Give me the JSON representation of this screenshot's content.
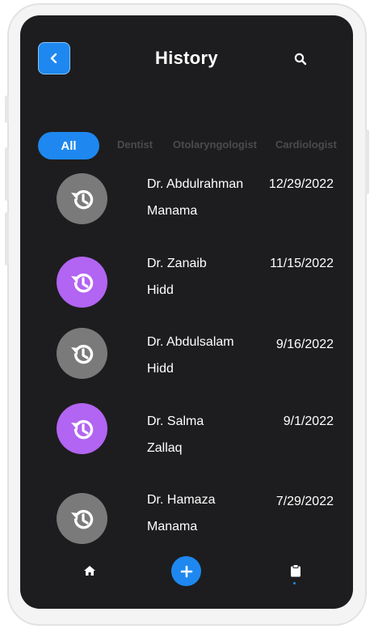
{
  "header": {
    "title": "History",
    "back_icon": "chevron-left-icon",
    "search_icon": "search-icon"
  },
  "filters": [
    "All",
    "Dentist",
    "Otolaryngologist",
    "Cardiologist"
  ],
  "active_filter": "All",
  "appointments": [
    {
      "name": "Dr. Abdulrahman",
      "location": "Manama",
      "date": "12/29/2022",
      "color": "#7a7a7a"
    },
    {
      "name": "Dr. Zanaib",
      "location": "Hidd",
      "date": "11/15/2022",
      "color": "#b264f2"
    },
    {
      "name": "Dr. Abdulsalam",
      "location": "Hidd",
      "date": "9/16/2022",
      "color": "#7a7a7a"
    },
    {
      "name": "Dr. Salma",
      "location": "Zallaq",
      "date": "9/1/2022",
      "color": "#b264f2"
    },
    {
      "name": "Dr. Hamaza",
      "location": "Manama",
      "date": "7/29/2022",
      "color": "#7a7a7a"
    }
  ],
  "bottom_nav": {
    "home_icon": "home-icon",
    "add_icon": "plus-icon",
    "history_icon": "clipboard-icon"
  },
  "colors": {
    "accent": "#1e88f0",
    "background": "#1d1d1f",
    "avatar_gray": "#7a7a7a",
    "avatar_purple": "#b264f2"
  }
}
